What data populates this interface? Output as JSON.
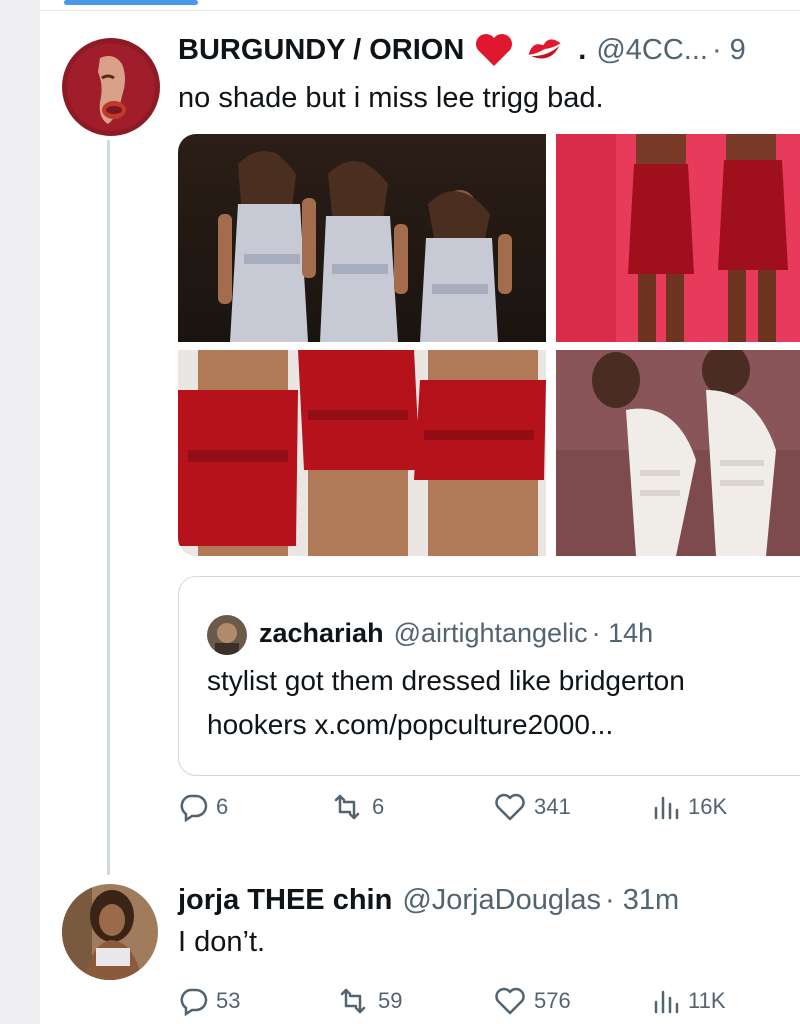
{
  "top_tab": {
    "indicator": "active"
  },
  "main_post": {
    "display_name": "BURGUNDY / ORION",
    "emojis": [
      "red-heart",
      "kiss-mark"
    ],
    "separator": ".",
    "handle": "@4CC...",
    "time": "· 9",
    "text": "no shade but i miss lee trigg bad.",
    "media": [
      {
        "name": "performance-photo-silver-outfits"
      },
      {
        "name": "red-outfits-photo"
      },
      {
        "name": "red-skirts-closeup-photo"
      },
      {
        "name": "white-ruffled-outfits-photo"
      }
    ],
    "quote": {
      "display_name": "zachariah",
      "handle": "@airtightangelic",
      "time": "· 14h",
      "text_line1": "stylist got them dressed like bridgerton",
      "text_line2": "hookers x.com/popculture2000..."
    },
    "stats": {
      "replies": "6",
      "reposts": "6",
      "likes": "341",
      "views": "16K"
    }
  },
  "reply_post": {
    "display_name": "jorja THEE chin",
    "handle": "@JorjaDouglas",
    "time": "· 31m",
    "text": "I don’t.",
    "stats": {
      "replies": "53",
      "reposts": "59",
      "likes": "576",
      "views": "11K"
    }
  },
  "colors": {
    "accent": "#4a99e9",
    "secondary_text": "#536471",
    "border": "#cfd9de",
    "heart": "#e0182d"
  },
  "icons": [
    "reply-icon",
    "repost-icon",
    "like-icon",
    "views-icon"
  ]
}
